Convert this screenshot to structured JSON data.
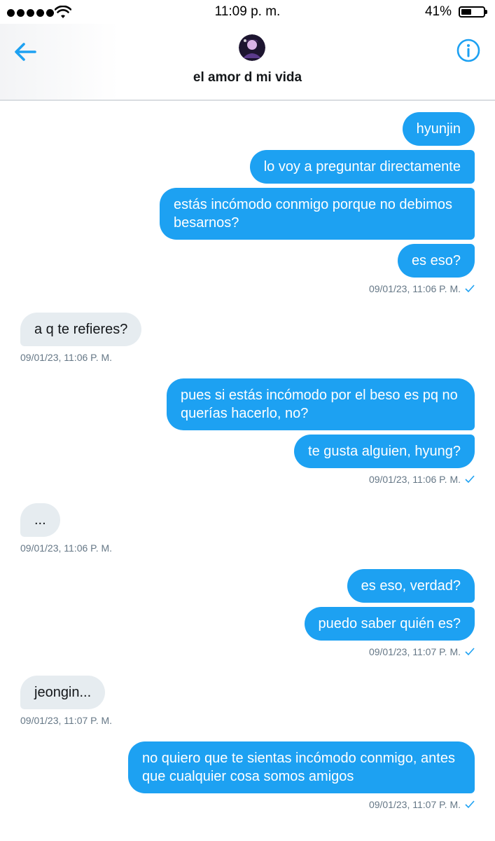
{
  "status_bar": {
    "time": "11:09 p. m.",
    "battery": "41%"
  },
  "header": {
    "title": "el amor d mi vida",
    "avatar_icon": "avatar-icon",
    "back_icon": "back-arrow-icon",
    "info_icon": "info-icon",
    "accent_color": "#1da1f2"
  },
  "groups": [
    {
      "side": "sent",
      "messages": [
        "hyunjin",
        "lo voy a preguntar directamente",
        "estás incómodo conmigo porque no debimos besarnos?",
        "es eso?"
      ],
      "timestamp": "09/01/23, 11:06 P. M."
    },
    {
      "side": "received",
      "messages": [
        "a q te refieres?"
      ],
      "timestamp": "09/01/23, 11:06 P. M."
    },
    {
      "side": "sent",
      "messages": [
        "pues si estás incómodo por el beso es pq no querías hacerlo, no?",
        "te gusta alguien, hyung?"
      ],
      "timestamp": "09/01/23, 11:06 P. M."
    },
    {
      "side": "received",
      "messages": [
        "..."
      ],
      "timestamp": "09/01/23, 11:06 P. M."
    },
    {
      "side": "sent",
      "messages": [
        "es eso, verdad?",
        "puedo saber quién es?"
      ],
      "timestamp": "09/01/23, 11:07 P. M."
    },
    {
      "side": "received",
      "messages": [
        "jeongin..."
      ],
      "timestamp": "09/01/23, 11:07 P. M."
    },
    {
      "side": "sent",
      "messages": [
        "no quiero que te sientas incómodo conmigo, antes que cualquier cosa somos amigos"
      ],
      "timestamp": "09/01/23, 11:07 P. M."
    }
  ]
}
